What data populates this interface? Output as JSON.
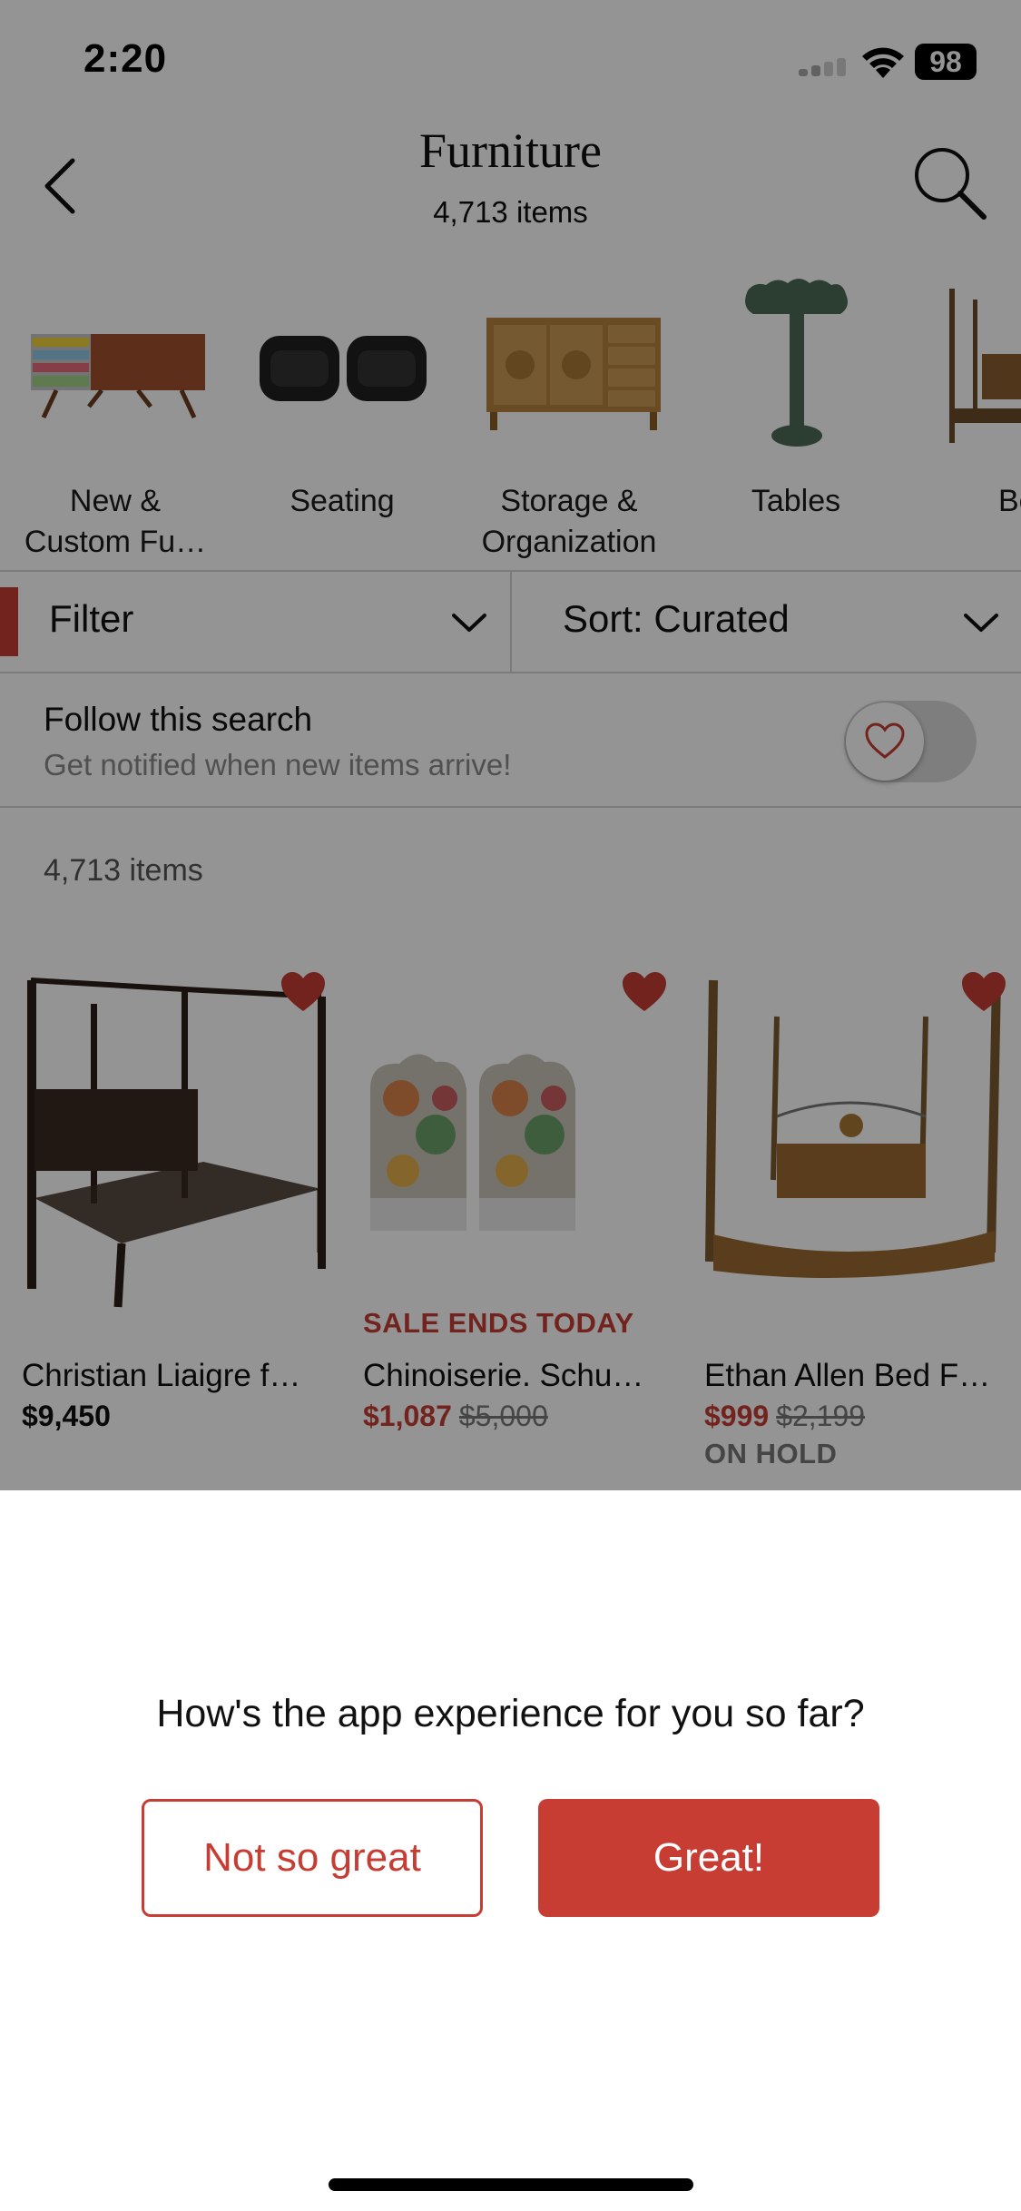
{
  "status_bar": {
    "time": "2:20",
    "battery": "98"
  },
  "header": {
    "title": "Furniture",
    "subtitle": "4,713 items",
    "back_icon": "chevron-left-icon",
    "search_icon": "search-icon"
  },
  "categories": [
    {
      "label": "New &\nCustom Fu…",
      "image": "credenza"
    },
    {
      "label": "Seating",
      "image": "swivel-chairs"
    },
    {
      "label": "Storage &\nOrganization",
      "image": "sideboard"
    },
    {
      "label": "Tables",
      "image": "pedestal-table"
    },
    {
      "label": "Be",
      "image": "bed"
    }
  ],
  "filter_bar": {
    "filter_label": "Filter",
    "sort_label": "Sort: Curated"
  },
  "follow": {
    "title": "Follow this search",
    "subtitle": "Get notified when new items arrive!",
    "toggle_on": false
  },
  "results": {
    "count_label": "4,713 items"
  },
  "products": [
    {
      "title": "Christian Liaigre f…",
      "price": "$9,450",
      "original_price": "",
      "sale_tag": "",
      "status_tag": "",
      "favorited": true
    },
    {
      "title": "Chinoiserie. Schu…",
      "price": "$1,087",
      "original_price": "$5,000",
      "sale_tag": "SALE ENDS TODAY",
      "status_tag": "",
      "favorited": true
    },
    {
      "title": "Ethan Allen Bed F…",
      "price": "$999",
      "original_price": "$2,199",
      "sale_tag": "",
      "status_tag": "ON HOLD",
      "favorited": true
    }
  ],
  "feedback": {
    "question": "How's the app experience for you so far?",
    "negative_label": "Not so great",
    "positive_label": "Great!"
  },
  "colors": {
    "accent": "#c73d33",
    "overlay": "rgba(0,0,0,0.42)"
  }
}
